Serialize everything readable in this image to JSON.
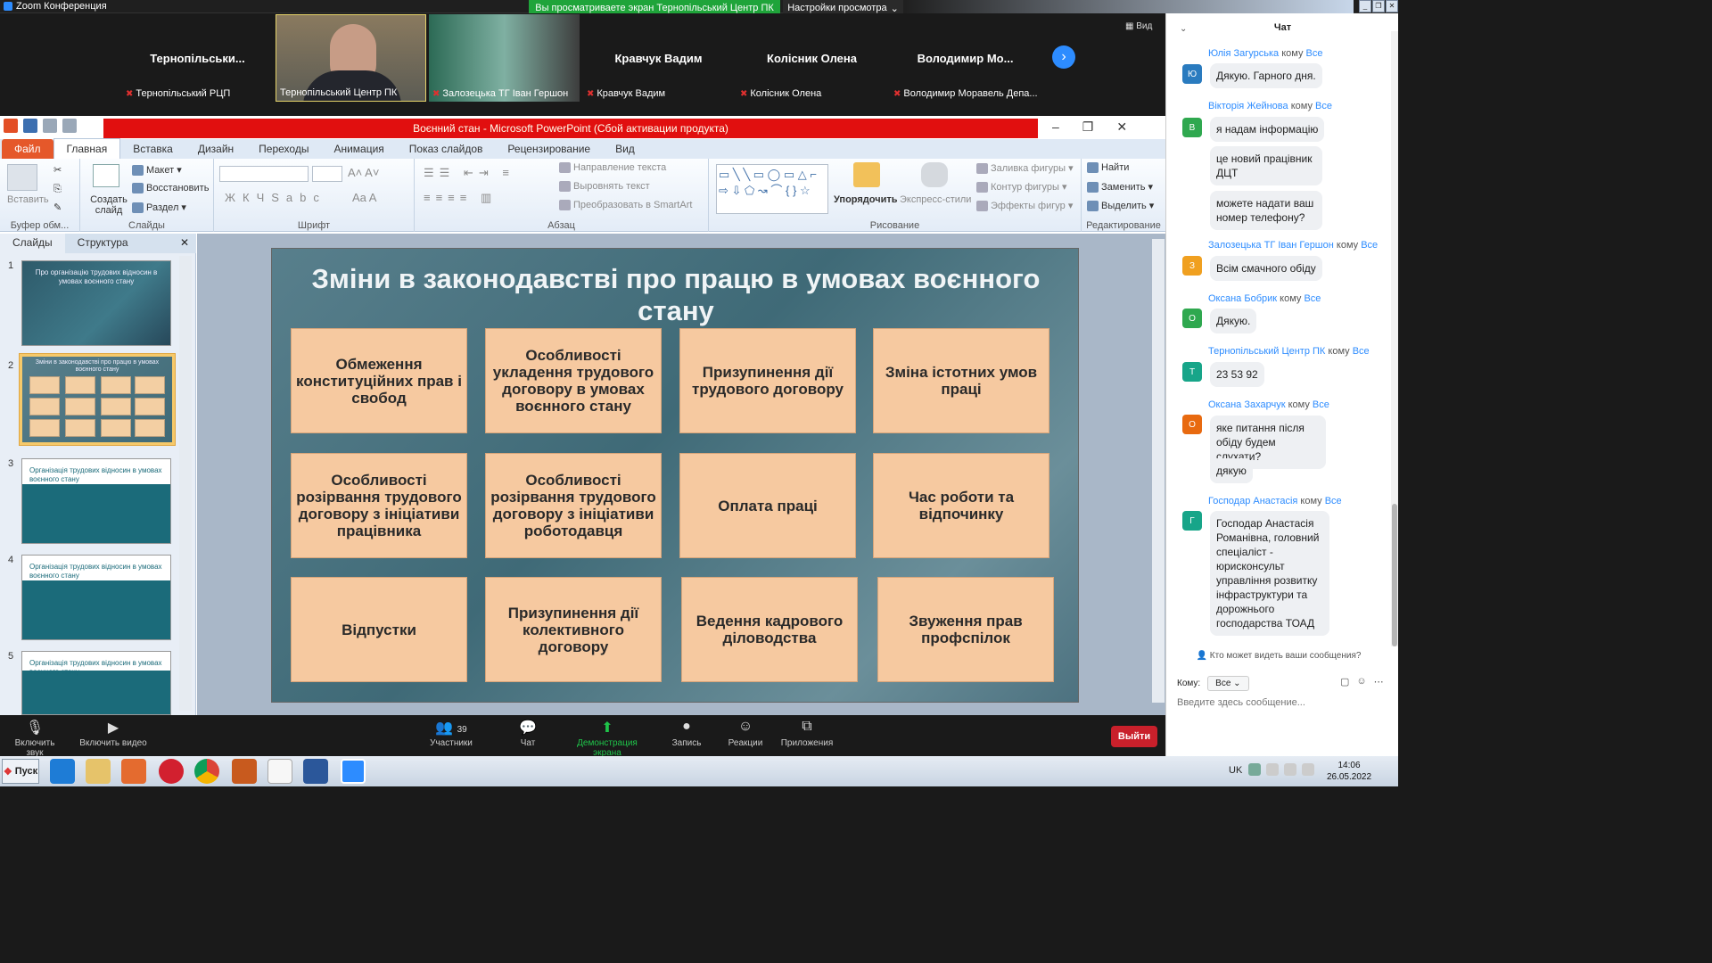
{
  "zoom": {
    "title": "Zoom Конференция",
    "share_banner": "Вы просматриваете экран Тернопільський Центр ПК",
    "view_options": "Настройки просмотра",
    "view_label": "Вид",
    "tiles": [
      {
        "name": "Тернопільськи...",
        "label": "Тернопільський РЦП"
      },
      {
        "name": "",
        "label": "Тернопільський Центр ПК"
      },
      {
        "name": "",
        "label": "Залозецька ТГ Іван Гершон"
      },
      {
        "name": "Кравчук Вадим",
        "label": "Кравчук Вадим"
      },
      {
        "name": "Колісник Олена",
        "label": "Колісник Олена"
      },
      {
        "name": "Володимир  Мо...",
        "label": "Володимир Моравель Депа..."
      }
    ],
    "controls": {
      "mute": "Включить звук",
      "video": "Включить видео",
      "participants": "Участники",
      "participants_count": "39",
      "chat": "Чат",
      "share": "Демонстрация экрана",
      "record": "Запись",
      "reactions": "Реакции",
      "apps": "Приложения",
      "leave": "Выйти"
    }
  },
  "ppt": {
    "title": "Воєнний стан  -  Microsoft PowerPoint (Сбой активации продукта)",
    "tabs": [
      "Файл",
      "Главная",
      "Вставка",
      "Дизайн",
      "Переходы",
      "Анимация",
      "Показ слайдов",
      "Рецензирование",
      "Вид"
    ],
    "ribbon": {
      "paste": "Вставить",
      "clipboard": "Буфер обм...",
      "new_slide": "Создать слайд",
      "layout": "Макет",
      "reset": "Восстановить",
      "section": "Раздел",
      "slides": "Слайды",
      "font": "Шрифт",
      "paragraph": "Абзац",
      "text_direction": "Направление текста",
      "align_text": "Выровнять текст",
      "smartart": "Преобразовать в SmartArt",
      "arrange": "Упорядочить",
      "quick_styles": "Экспресс-стили",
      "shape_fill": "Заливка фигуры",
      "shape_outline": "Контур фигуры",
      "shape_effects": "Эффекты фигур",
      "drawing": "Рисование",
      "find": "Найти",
      "replace": "Заменить",
      "select": "Выделить",
      "editing": "Редактирование"
    },
    "pane_tabs": [
      "Слайды",
      "Структура"
    ],
    "thumbs": [
      {
        "num": "1",
        "text": "Про організацію трудових відносин в умовах воєнного стану"
      },
      {
        "num": "2",
        "text": "Зміни в законодавстві про працю в умовах воєнного стану"
      },
      {
        "num": "3",
        "text": "Організація трудових відносин в умовах воєнного стану"
      },
      {
        "num": "4",
        "text": "Організація трудових відносин в умовах воєнного стану"
      },
      {
        "num": "5",
        "text": "Організація трудових відносин в умовах воєнного стану"
      }
    ],
    "slide": {
      "title": "Зміни в законодавстві про працю в умовах воєнного стану",
      "cards": [
        "Обмеження конституційних прав і свобод",
        "Особливості укладення трудового договору в умовах воєнного стану",
        "Призупинення дії трудового договору",
        "Зміна істотних умов праці",
        "Особливості розірвання трудового договору з ініціативи працівника",
        "Особливості розірвання трудового договору з ініціативи роботодавця",
        "Оплата праці",
        "Час роботи та відпочинку",
        "Відпустки",
        "Призупинення дії колективного договору",
        "Ведення кадрового діловодства",
        "Звуження прав профспілок"
      ]
    }
  },
  "chat": {
    "header": "Чат",
    "to_word": "кому",
    "all": "Все",
    "messages": [
      {
        "sender": "Юлія Загурська",
        "avatar": "Ю",
        "color": "#2a7bbf",
        "texts": [
          "Дякую. Гарного дня."
        ]
      },
      {
        "sender": "Вікторія Жейнова",
        "avatar": "В",
        "color": "#2fa84f",
        "texts": [
          "я надам інформацію",
          "це новий працівник ДЦТ",
          "можете надати ваш номер телефону?"
        ]
      },
      {
        "sender": "Залозецька ТГ Іван Гершон",
        "avatar": "З",
        "color": "#f0a020",
        "texts": [
          "Всім смачного обіду"
        ]
      },
      {
        "sender": "Оксана Бобрик",
        "avatar": "О",
        "color": "#2fa84f",
        "texts": [
          "Дякую."
        ]
      },
      {
        "sender": "Тернопільський Центр ПК",
        "avatar": "Т",
        "color": "#17a589",
        "texts": [
          "23 53 92"
        ]
      },
      {
        "sender": "Оксана Захарчук",
        "avatar": "О",
        "color": "#e86a10",
        "texts": [
          "яке питання після обіду будем слухати?",
          "дякую"
        ]
      },
      {
        "sender": "Господар Анастасія",
        "avatar": "Г",
        "color": "#17a589",
        "texts": [
          "Господар Анастасія Романівна, головний спеціаліст - юрисконсульт управління розвитку інфраструктури та дорожнього господарства ТОАД"
        ]
      }
    ],
    "who_can_see": "Кто может видеть ваши сообщения?",
    "to_label": "Кому:",
    "to_value": "Все",
    "input_placeholder": "Введите здесь сообщение..."
  },
  "taskbar": {
    "start": "Пуск",
    "lang": "UK",
    "time": "14:06",
    "date": "26.05.2022"
  }
}
